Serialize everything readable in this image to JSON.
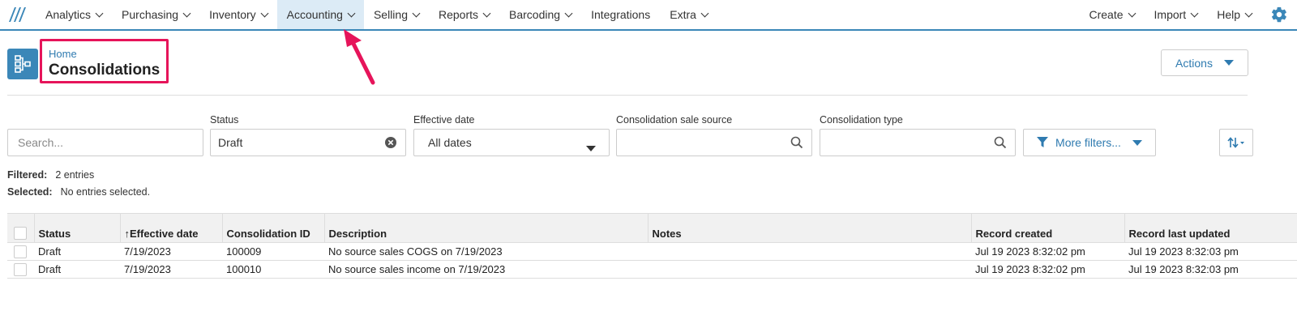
{
  "nav": {
    "items": [
      {
        "label": "Analytics"
      },
      {
        "label": "Purchasing"
      },
      {
        "label": "Inventory"
      },
      {
        "label": "Accounting"
      },
      {
        "label": "Selling"
      },
      {
        "label": "Reports"
      },
      {
        "label": "Barcoding"
      },
      {
        "label": "Integrations"
      },
      {
        "label": "Extra"
      }
    ],
    "right": [
      {
        "label": "Create"
      },
      {
        "label": "Import"
      },
      {
        "label": "Help"
      }
    ],
    "active": "Accounting",
    "settings_icon": "gear-icon",
    "accent_color": "#3b87b8"
  },
  "header": {
    "breadcrumb": "Home",
    "title": "Consolidations",
    "actions_label": "Actions",
    "page_icon": "hierarchy-icon",
    "highlight_color": "#e6145a"
  },
  "filters": {
    "search_placeholder": "Search...",
    "status_label": "Status",
    "status_value": "Draft",
    "effective_date_label": "Effective date",
    "effective_date_value": "All dates",
    "sale_source_label": "Consolidation sale source",
    "type_label": "Consolidation type",
    "more_filters_label": "More filters..."
  },
  "summary": {
    "filtered_label": "Filtered:",
    "filtered_value": "2 entries",
    "selected_label": "Selected:",
    "selected_value": "No entries selected."
  },
  "table": {
    "columns": [
      "Status",
      "Effective date",
      "Consolidation ID",
      "Description",
      "Notes",
      "Record created",
      "Record last updated"
    ],
    "rows": [
      [
        "Draft",
        "7/19/2023",
        "100009",
        "No source sales COGS on 7/19/2023",
        "",
        "Jul 19 2023 8:32:02 pm",
        "Jul 19 2023 8:32:03 pm"
      ],
      [
        "Draft",
        "7/19/2023",
        "100010",
        "No source sales income on 7/19/2023",
        "",
        "Jul 19 2023 8:32:02 pm",
        "Jul 19 2023 8:32:03 pm"
      ]
    ]
  }
}
